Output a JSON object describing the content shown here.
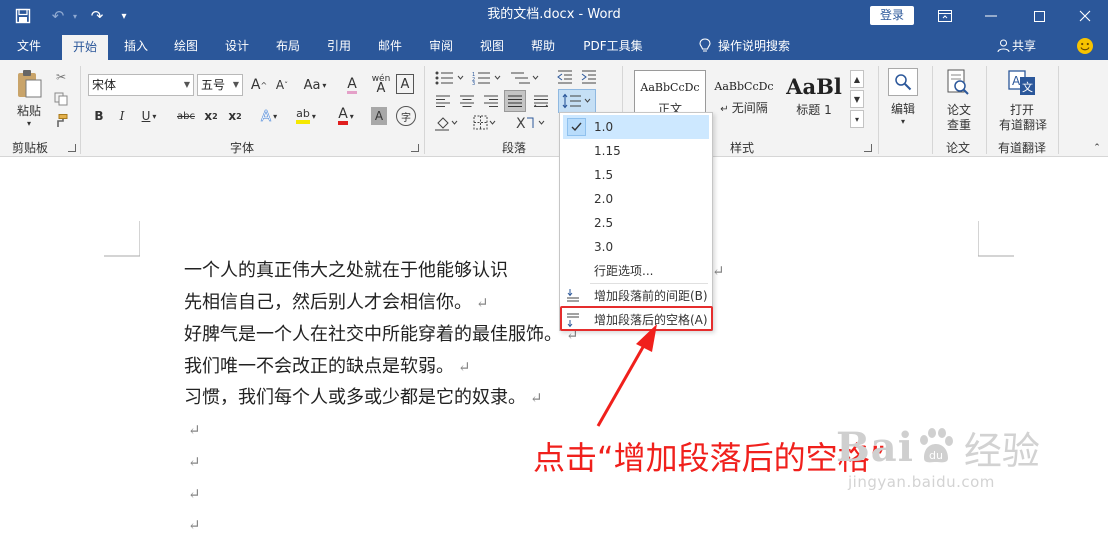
{
  "titlebar": {
    "doc_title": "我的文档.docx  -  Word",
    "login_label": "登录"
  },
  "tabs": [
    "文件",
    "开始",
    "插入",
    "绘图",
    "设计",
    "布局",
    "引用",
    "邮件",
    "审阅",
    "视图",
    "帮助",
    "PDF工具集"
  ],
  "active_tab": "开始",
  "tell_me": "操作说明搜索",
  "share_label": "共享",
  "ribbon": {
    "clipboard": {
      "paste_label": "粘贴",
      "group_label": "剪贴板"
    },
    "font": {
      "font_name": "宋体",
      "font_size": "五号",
      "grow": "A",
      "shrink": "A",
      "case": "Aa",
      "clear_fmt": "A",
      "phonetic": "wén",
      "phonetic_sub": "A",
      "border_char": "A",
      "bold": "B",
      "italic": "I",
      "underline": "U",
      "strike": "abc",
      "sub": "x",
      "sup": "x",
      "effects": "A",
      "highlight": "ab",
      "font_color": "A",
      "shade": "A",
      "enclose": "字",
      "group_label": "字体"
    },
    "paragraph": {
      "group_label": "段落"
    },
    "styles": {
      "items": [
        {
          "sample": "AaBbCcDc",
          "name": "正文"
        },
        {
          "sample": "AaBbCcDc",
          "name": "无间隔"
        },
        {
          "sample": "AaBl",
          "name": "标题 1"
        }
      ],
      "group_label": "样式"
    },
    "editing": {
      "label": "编辑"
    },
    "paper": {
      "label_line1": "论文",
      "label_line2": "查重",
      "group_label": "论文"
    },
    "youdao": {
      "label_line1": "打开",
      "label_line2": "有道翻译",
      "group_label": "有道翻译"
    }
  },
  "line_spacing_menu": {
    "items": [
      {
        "label": "1.0",
        "checked": true
      },
      {
        "label": "1.15",
        "checked": false
      },
      {
        "label": "1.5",
        "checked": false
      },
      {
        "label": "2.0",
        "checked": false
      },
      {
        "label": "2.5",
        "checked": false
      },
      {
        "label": "3.0",
        "checked": false
      }
    ],
    "options_label": "行距选项...",
    "add_before_label": "增加段落前的间距(B)",
    "add_after_label": "增加段落后的空格(A)"
  },
  "document": {
    "lines": [
      "一个人的真正伟大之处就在于他能够认识",
      "先相信自己，然后别人才会相信你。",
      "好脾气是一个人在社交中所能穿着的最佳服饰。",
      "我们唯一不会改正的缺点是软弱。",
      "习惯，我们每个人或多或少都是它的奴隶。"
    ],
    "paragraph_mark": "↵"
  },
  "annotation": "点击“增加段落后的空格”",
  "watermark": {
    "brand": "Bai",
    "brand_suffix": "经验",
    "url": "jingyan.baidu.com"
  },
  "colors": {
    "accent": "#2b579a",
    "annotation": "#f0201c",
    "highlight_box": "#e52d2d"
  }
}
